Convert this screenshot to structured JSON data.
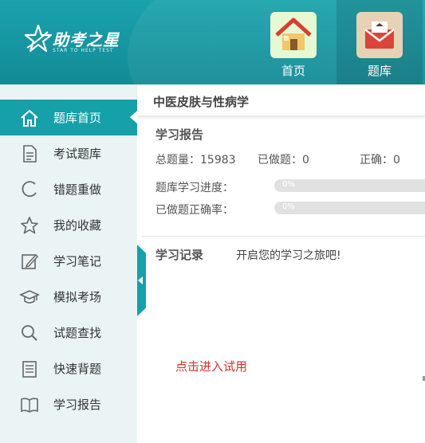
{
  "header": {
    "logo_text": "助考之星",
    "logo_sub": "STAR TO HELP TEST",
    "nav": [
      {
        "label": "首页",
        "icon": "house-icon"
      },
      {
        "label": "题库",
        "icon": "mail-icon"
      }
    ]
  },
  "sidebar": {
    "items": [
      {
        "label": "题库首页",
        "icon": "home-outline-icon",
        "active": true
      },
      {
        "label": "考试题库",
        "icon": "document-icon"
      },
      {
        "label": "错题重做",
        "icon": "refresh-icon"
      },
      {
        "label": "我的收藏",
        "icon": "star-icon"
      },
      {
        "label": "学习笔记",
        "icon": "edit-icon"
      },
      {
        "label": "模拟考场",
        "icon": "graduation-cap-icon"
      },
      {
        "label": "试题查找",
        "icon": "search-icon"
      },
      {
        "label": "快速背题",
        "icon": "notepad-icon"
      },
      {
        "label": "学习报告",
        "icon": "book-icon"
      }
    ]
  },
  "main": {
    "subject": "中医皮肤与性病学",
    "report_title": "学习报告",
    "stats": {
      "total": "总题量：15983",
      "done": "已做题：0",
      "correct": "正确：0"
    },
    "progress": {
      "bank_label": "题库学习进度：",
      "bank_value": "0%",
      "bank_fraction": 0,
      "accuracy_label": "已做题正确率：",
      "accuracy_value": "0%",
      "accuracy_fraction": 0
    },
    "record_title": "学习记录",
    "record_hint": "开启您的学习之旅吧!",
    "trial_link": "点击进入试用"
  },
  "colors": {
    "accent": "#16a0aa",
    "header": "#1aa3ad",
    "sidebar_bg": "#eaf4f4",
    "link_red": "#d9302b"
  }
}
